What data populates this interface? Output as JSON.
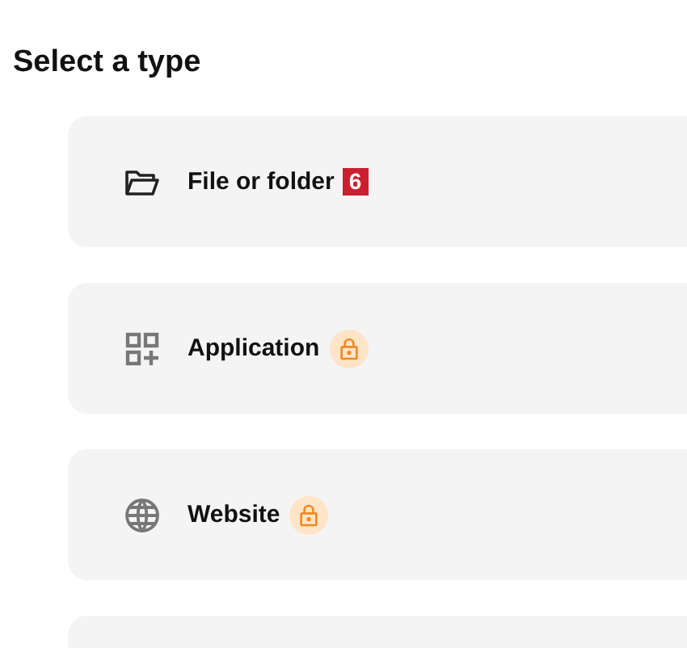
{
  "heading": "Select a type",
  "types": [
    {
      "kind": "folder",
      "label": "File or folder",
      "badge": "6",
      "locked": false
    },
    {
      "kind": "application",
      "label": "Application",
      "locked": true
    },
    {
      "kind": "website",
      "label": "Website",
      "locked": true
    },
    {
      "kind": "blank"
    }
  ]
}
